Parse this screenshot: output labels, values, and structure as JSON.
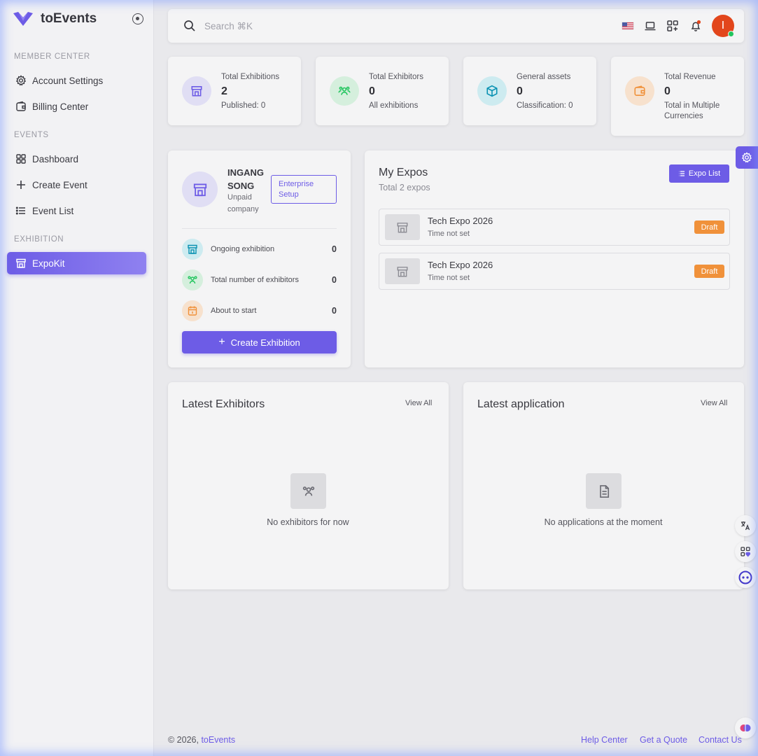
{
  "brand": {
    "name": "toEvents"
  },
  "sidebar": {
    "sections": [
      {
        "title": "MEMBER CENTER"
      },
      {
        "title": "EVENTS"
      },
      {
        "title": "EXHIBITION"
      }
    ],
    "items": [
      {
        "label": "Account Settings",
        "icon": "gear-icon"
      },
      {
        "label": "Billing Center",
        "icon": "wallet-icon"
      },
      {
        "label": "Dashboard",
        "icon": "grid-icon"
      },
      {
        "label": "Create Event",
        "icon": "plus-icon"
      },
      {
        "label": "Event List",
        "icon": "list-icon"
      },
      {
        "label": "ExpoKit",
        "icon": "store-icon",
        "active": true
      }
    ]
  },
  "search": {
    "placeholder": "Search ⌘K"
  },
  "user": {
    "initial": "I"
  },
  "stats": [
    {
      "label": "Total Exhibitions",
      "value": "2",
      "sub": "Published: 0",
      "icon": "store-icon",
      "color": "#6d5ce6"
    },
    {
      "label": "Total Exhibitors",
      "value": "0",
      "sub": "All exhibitions",
      "icon": "users-icon",
      "color": "#22c55e"
    },
    {
      "label": "General assets",
      "value": "0",
      "sub": "Classification: 0",
      "icon": "cube-icon",
      "color": "#06b6d4"
    },
    {
      "label": "Total Revenue",
      "value": "0",
      "sub": "Total in Multiple Currencies",
      "icon": "wallet-icon",
      "color": "#f0913a"
    }
  ],
  "profile": {
    "name": "INGANG SONG",
    "status": "Unpaid company",
    "enterprise_button": "Enterprise Setup",
    "metrics": [
      {
        "label": "Ongoing exhibition",
        "value": "0",
        "icon": "store-icon"
      },
      {
        "label": "Total number of exhibitors",
        "value": "0",
        "icon": "users-icon"
      },
      {
        "label": "About to start",
        "value": "0",
        "icon": "calendar-icon"
      }
    ],
    "create_button": "Create Exhibition"
  },
  "my_expos": {
    "title": "My Expos",
    "subtitle": "Total 2 expos",
    "list_button": "Expo List",
    "items": [
      {
        "name": "Tech Expo 2026",
        "time": "Time not set",
        "status": "Draft"
      },
      {
        "name": "Tech Expo 2026",
        "time": "Time not set",
        "status": "Draft"
      }
    ]
  },
  "latest_exhibitors": {
    "title": "Latest Exhibitors",
    "view_all": "View All",
    "empty": "No exhibitors for now"
  },
  "latest_application": {
    "title": "Latest application",
    "view_all": "View All",
    "empty": "No applications at the moment"
  },
  "footer": {
    "copyright": "© 2026, ",
    "brand": "toEvents",
    "links": [
      "Help Center",
      "Get a Quote",
      "Contact Us"
    ]
  }
}
